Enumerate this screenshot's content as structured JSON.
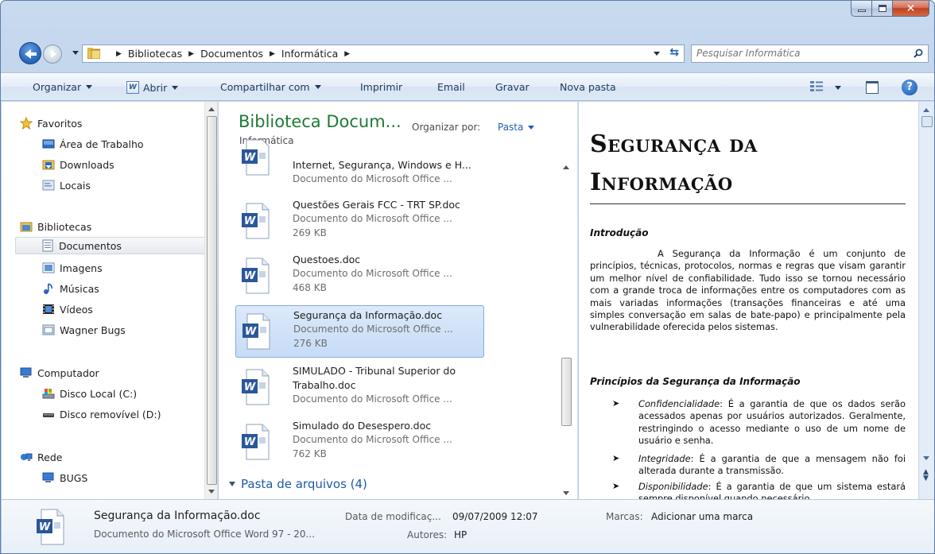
{
  "address": {
    "crumbs": [
      "Bibliotecas",
      "Documentos",
      "Informática"
    ]
  },
  "search": {
    "placeholder": "Pesquisar Informática"
  },
  "toolbar": {
    "organize": "Organizar",
    "open": "Abrir",
    "share": "Compartilhar com",
    "print": "Imprimir",
    "email": "Email",
    "burn": "Gravar",
    "new_folder": "Nova pasta"
  },
  "nav": {
    "favorites": "Favoritos",
    "desktop": "Área de Trabalho",
    "downloads": "Downloads",
    "places": "Locais",
    "libraries": "Bibliotecas",
    "documents": "Documentos",
    "images": "Imagens",
    "music": "Músicas",
    "videos": "Vídeos",
    "wagner": "Wagner Bugs",
    "computer": "Computador",
    "disk_c": "Disco Local (C:)",
    "disk_d": "Disco removível (D:)",
    "network": "Rede",
    "bugs": "BUGS"
  },
  "library": {
    "title": "Biblioteca Docum...",
    "subtitle": "Informática",
    "arrange_label": "Organizar por:",
    "arrange_value": "Pasta"
  },
  "files": [
    {
      "name": "Internet, Segurança, Windows e H...",
      "type": "Documento do Microsoft Office ...",
      "size": ""
    },
    {
      "name": "Questões Gerais FCC - TRT SP.doc",
      "type": "Documento do Microsoft Office ...",
      "size": "269 KB"
    },
    {
      "name": "Questoes.doc",
      "type": "Documento do Microsoft Office ...",
      "size": "468 KB"
    },
    {
      "name": "Segurança da Informação.doc",
      "type": "Documento do Microsoft Office ...",
      "size": "276 KB"
    },
    {
      "name": "SIMULADO - Tribunal Superior do",
      "name2": "Trabalho.doc",
      "type": "Documento do Microsoft Office ...",
      "size": ""
    },
    {
      "name": "Simulado do Desespero.doc",
      "type": "Documento do Microsoft Office ...",
      "size": "762 KB"
    }
  ],
  "group_header": "Pasta de arquivos (4)",
  "preview": {
    "title": "Segurança da Informação",
    "intro_heading": "Introdução",
    "intro_text": "A Segurança da Informação é um conjunto de princípios, técnicas, protocolos, normas e regras que visam garantir um melhor nível de confiabilidade. Tudo isso se tornou necessário com a grande troca de informações entre os computadores com as mais variadas informações (transações financeiras e até uma simples conversação em salas de bate-papo) e principalmente pela vulnerabilidade oferecida pelos sistemas.",
    "principles_heading": "Princípios da Segurança da Informação",
    "bullets": [
      {
        "term": "Confidencialidade",
        "text": ": É a garantia de que os dados serão acessados apenas por usuários autorizados. Geralmente, restringindo o acesso mediante o uso de um nome de usuário e senha."
      },
      {
        "term": "Integridade",
        "text": ": É a garantia de que a mensagem não foi alterada durante a transmissão."
      },
      {
        "term": "Disponibilidade",
        "text": ": É a garantia de que um sistema estará sempre disponível quando necessário."
      }
    ]
  },
  "details": {
    "name": "Segurança da Informação.doc",
    "type": "Documento do Microsoft Office Word 97 - 20...",
    "modified_label": "Data de modificaç...",
    "modified_value": "09/07/2009 12:07",
    "authors_label": "Autores:",
    "authors_value": "HP",
    "tags_label": "Marcas:",
    "tags_value": "Adicionar uma marca"
  }
}
